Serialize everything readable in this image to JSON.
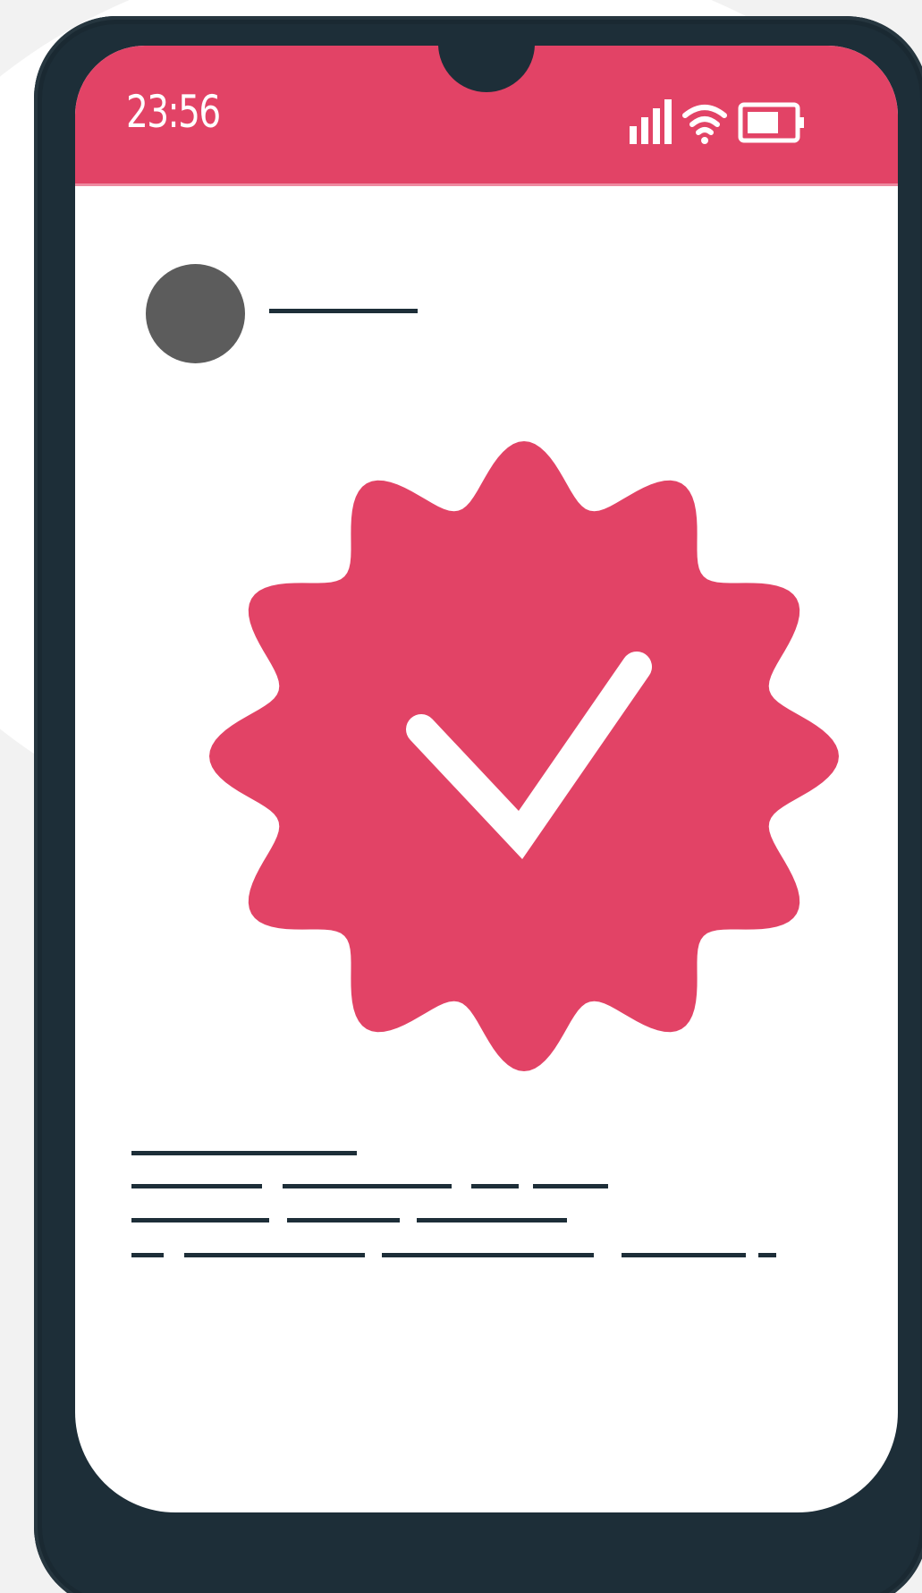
{
  "status_bar": {
    "time": "23:56",
    "icons": [
      "signal-icon",
      "wifi-icon",
      "battery-icon"
    ],
    "color": "#e24366"
  },
  "profile": {
    "avatar_color": "#5c5c5c"
  },
  "badge": {
    "icon": "verified-badge-icon",
    "checkmark_icon": "checkmark-icon",
    "color": "#e24366"
  },
  "colors": {
    "phone_body": "#1d2e38",
    "screen": "#ffffff",
    "background": "#f2f2f2"
  }
}
